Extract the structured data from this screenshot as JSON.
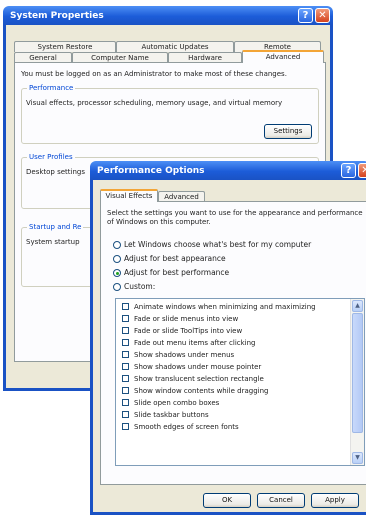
{
  "system_properties": {
    "title": "System Properties",
    "tabs_back": [
      "System Restore",
      "Automatic Updates",
      "Remote"
    ],
    "tabs_front": [
      "General",
      "Computer Name",
      "Hardware",
      "Advanced"
    ],
    "admin_note": "You must be logged on as an Administrator to make most of these changes.",
    "performance": {
      "label": "Performance",
      "description": "Visual effects, processor scheduling, memory usage, and virtual memory",
      "settings_button": "Settings"
    },
    "user_profiles": {
      "label": "User Profiles",
      "description": "Desktop settings"
    },
    "startup": {
      "label": "Startup and Re",
      "description": "System startup"
    }
  },
  "performance_options": {
    "title": "Performance Options",
    "tabs": [
      "Visual Effects",
      "Advanced"
    ],
    "intro": "Select the settings you want to use for the appearance and performance of Windows on this computer.",
    "radios": [
      {
        "label": "Let Windows choose what's best for my computer",
        "selected": false
      },
      {
        "label": "Adjust for best appearance",
        "selected": false
      },
      {
        "label": "Adjust for best performance",
        "selected": true
      },
      {
        "label": "Custom:",
        "selected": false
      }
    ],
    "effects": [
      "Animate windows when minimizing and maximizing",
      "Fade or slide menus into view",
      "Fade or slide ToolTips into view",
      "Fade out menu items after clicking",
      "Show shadows under menus",
      "Show shadows under mouse pointer",
      "Show translucent selection rectangle",
      "Show window contents while dragging",
      "Slide open combo boxes",
      "Slide taskbar buttons",
      "Smooth edges of screen fonts"
    ],
    "buttons": {
      "ok": "OK",
      "cancel": "Cancel",
      "apply": "Apply"
    }
  },
  "colors": {
    "titlebar": "#1c5cd8",
    "dialog_bg": "#ece9d8",
    "group_label": "#0046d5",
    "close_button": "#d4421e"
  }
}
